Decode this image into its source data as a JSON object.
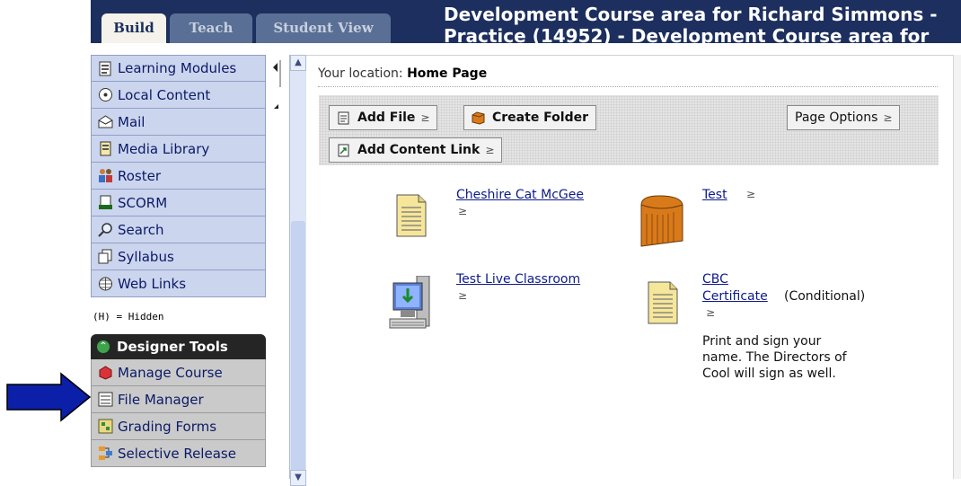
{
  "header": {
    "tabs": [
      "Build",
      "Teach",
      "Student View"
    ],
    "title_line1": "Development Course area for Richard Simmons -",
    "title_line2": "Practice (14952) - Development Course area for"
  },
  "sidebar": {
    "items": [
      {
        "label": "Learning Modules",
        "icon": "learning-modules-icon"
      },
      {
        "label": "Local Content",
        "icon": "local-content-icon"
      },
      {
        "label": "Mail",
        "icon": "mail-icon"
      },
      {
        "label": "Media Library",
        "icon": "media-library-icon"
      },
      {
        "label": "Roster",
        "icon": "roster-icon"
      },
      {
        "label": "SCORM",
        "icon": "scorm-icon"
      },
      {
        "label": "Search",
        "icon": "search-icon"
      },
      {
        "label": "Syllabus",
        "icon": "syllabus-icon"
      },
      {
        "label": "Web Links",
        "icon": "web-links-icon"
      }
    ],
    "hidden_note": "(H) = Hidden",
    "designer_tools_title": "Designer Tools",
    "tools": [
      {
        "label": "Manage Course",
        "icon": "manage-course-icon"
      },
      {
        "label": "File Manager",
        "icon": "file-manager-icon"
      },
      {
        "label": "Grading Forms",
        "icon": "grading-forms-icon"
      },
      {
        "label": "Selective Release",
        "icon": "selective-release-icon"
      }
    ]
  },
  "main": {
    "location_label": "Your location:",
    "location_value": "Home Page",
    "toolbar": {
      "add_file": "Add File",
      "create_folder": "Create Folder",
      "page_options": "Page Options",
      "add_content_link": "Add Content Link"
    },
    "items": [
      {
        "title": "Cheshire Cat McGee",
        "icon": "document-icon"
      },
      {
        "title": "Test",
        "icon": "test-chest-icon"
      },
      {
        "title": "Test Live Classroom",
        "icon": "computer-icon"
      },
      {
        "title_line1": "CBC",
        "title_line2": "Certificate",
        "status": "(Conditional)",
        "icon": "document-icon",
        "description": [
          "Print and sign your",
          "name. The Directors of",
          "Cool will sign as well."
        ]
      }
    ]
  },
  "colors": {
    "header_bg": "#1c2f5e",
    "nav_bg": "#ccd5ee",
    "tools_bg": "#cacaca",
    "link": "#0b1a8c",
    "arrow": "#0b1fa8"
  }
}
